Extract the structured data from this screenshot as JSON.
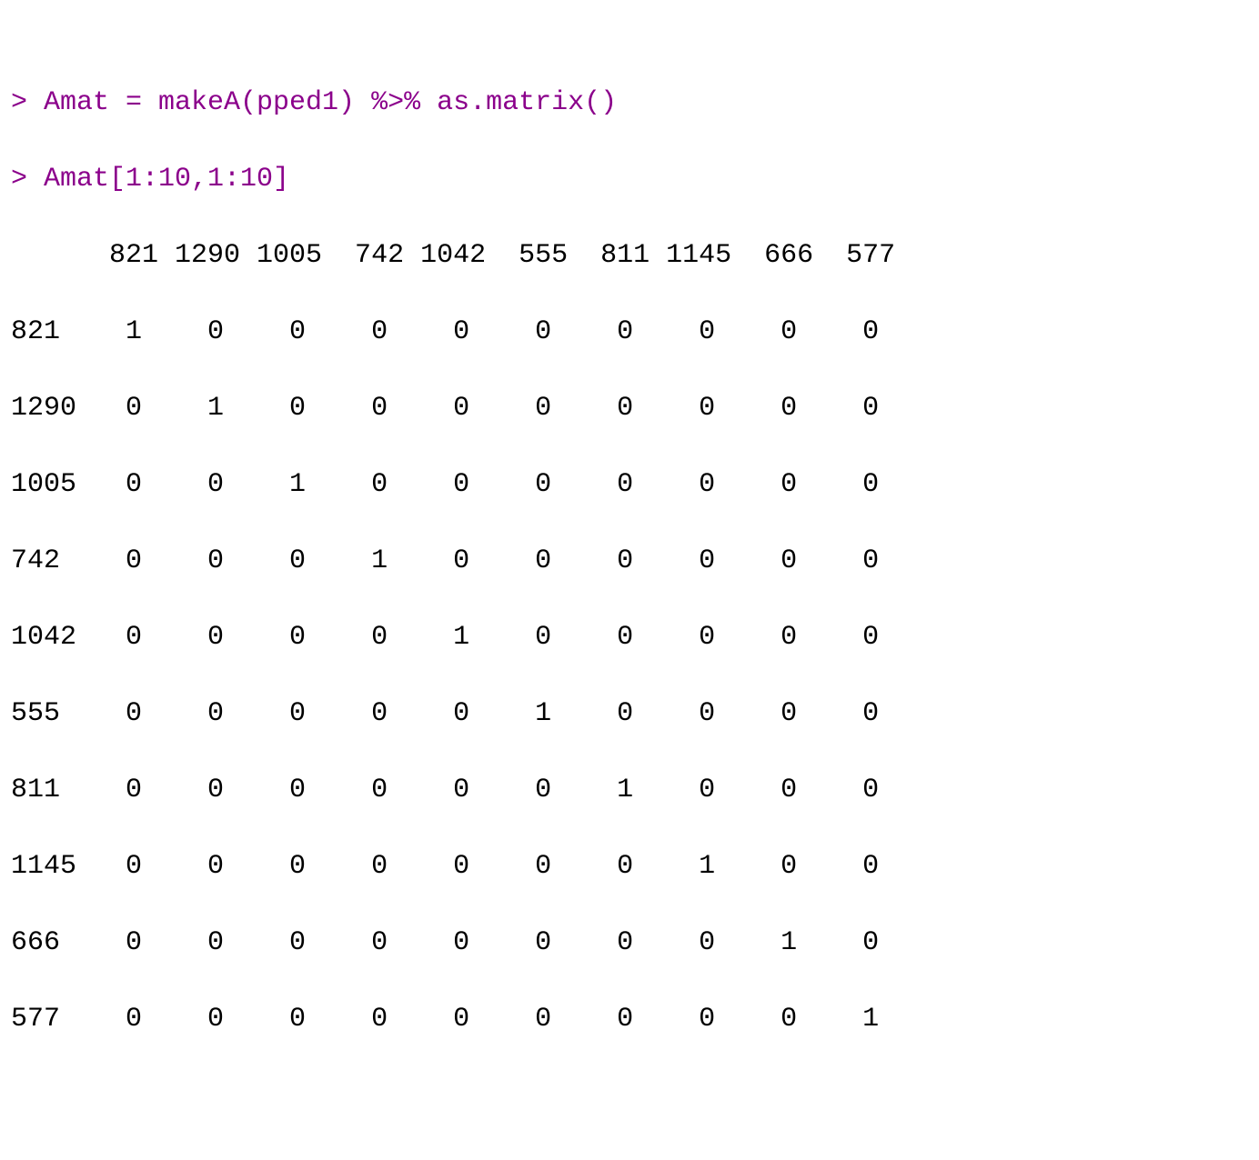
{
  "console": {
    "cmd1": "> Amat = makeA(pped1) %>% as.matrix()",
    "cmd2": "> Amat[1:10,1:10]"
  },
  "matrix": {
    "header": "      821 1290 1005  742 1042  555  811 1145  666  577",
    "rows": [
      "821    1    0    0    0    0    0    0    0    0    0",
      "1290   0    1    0    0    0    0    0    0    0    0",
      "1005   0    0    1    0    0    0    0    0    0    0",
      "742    0    0    0    1    0    0    0    0    0    0",
      "1042   0    0    0    0    1    0    0    0    0    0",
      "555    0    0    0    0    0    1    0    0    0    0",
      "811    0    0    0    0    0    0    1    0    0    0",
      "1145   0    0    0    0    0    0    0    1    0    0",
      "666    0    0    0    0    0    0    0    0    1    0",
      "577    0    0    0    0    0    0    0    0    0    1"
    ]
  }
}
